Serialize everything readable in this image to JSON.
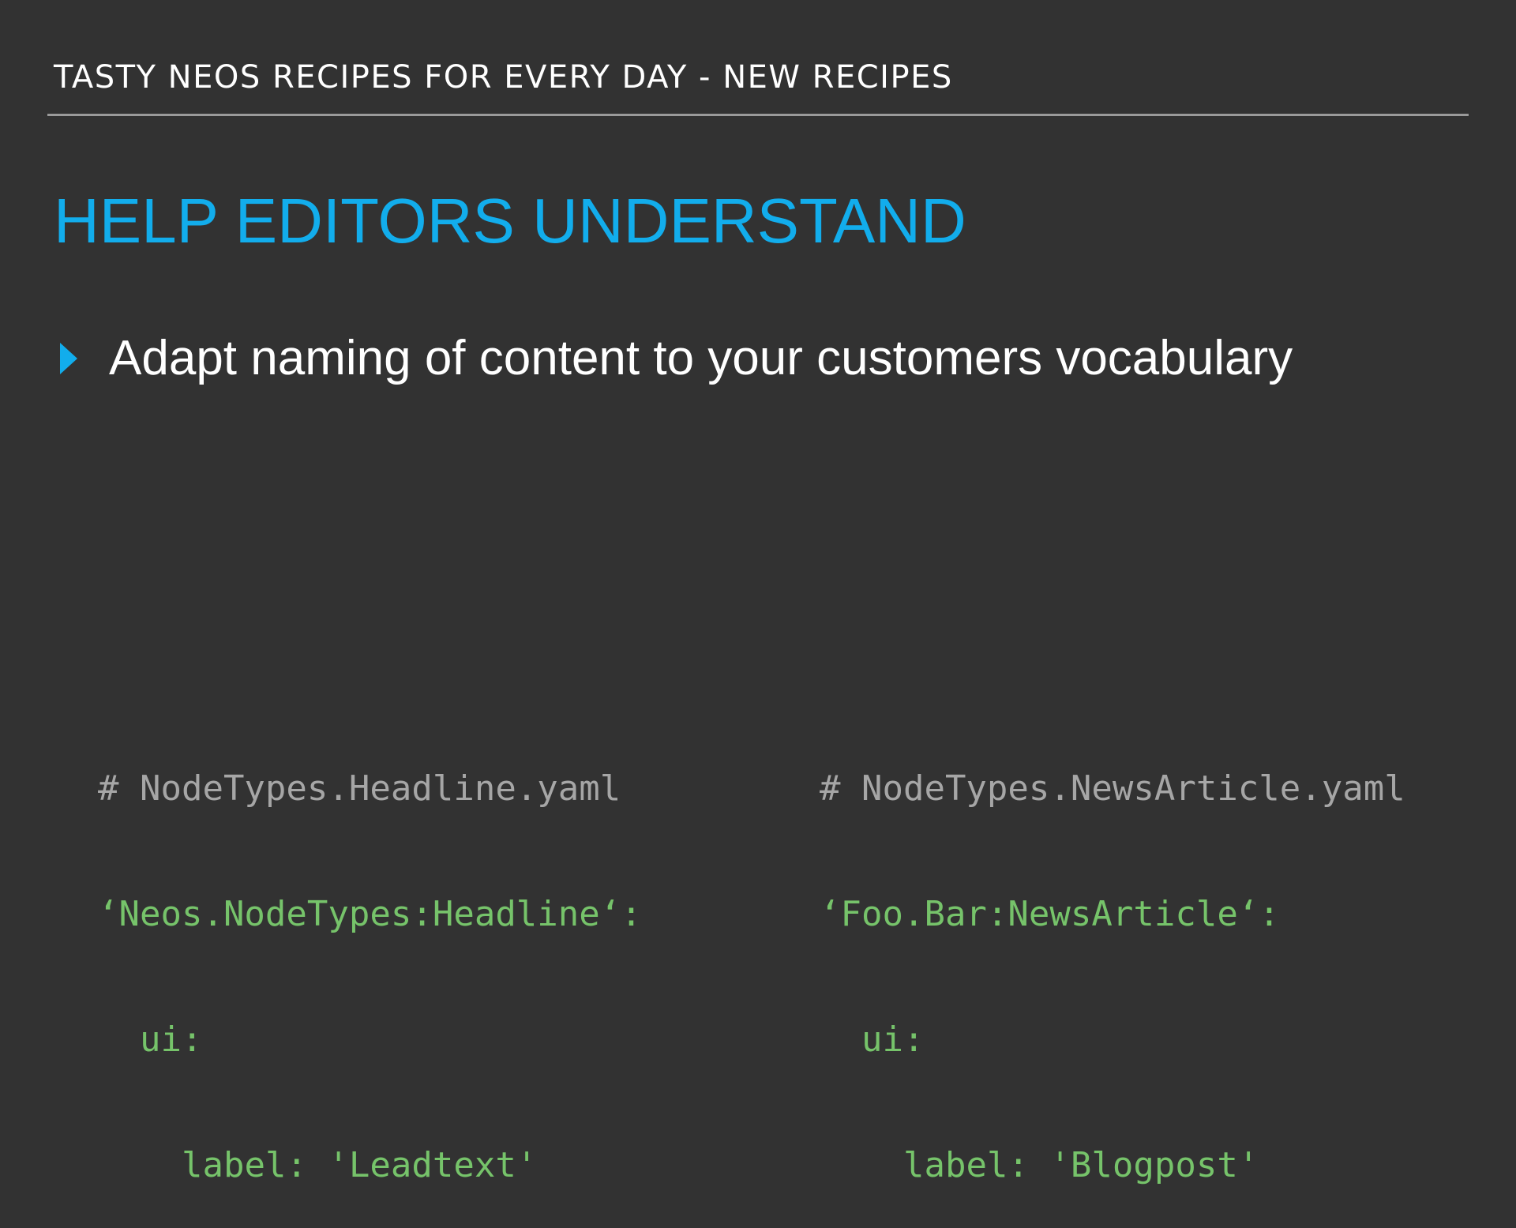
{
  "header": {
    "title": "TASTY NEOS RECIPES FOR EVERY DAY - NEW RECIPES"
  },
  "slide": {
    "title": "HELP EDITORS UNDERSTAND",
    "bullets": [
      "Adapt naming of content to your customers vocabulary"
    ]
  },
  "code_blocks": [
    {
      "comment": "# NodeTypes.Headline.yaml",
      "node_type": "‘Neos.NodeTypes:Headline‘:",
      "ui_key": "ui:",
      "label_line": "label: 'Leadtext'"
    },
    {
      "comment": "# NodeTypes.NewsArticle.yaml",
      "node_type": "‘Foo.Bar:NewsArticle‘:",
      "ui_key": "ui:",
      "label_line": "label: 'Blogpost'"
    }
  ],
  "colors": {
    "background": "#323232",
    "accent": "#12adec",
    "code_comment": "#a6a6a6",
    "code_yaml": "#76c36a",
    "rule": "#9a9a9a"
  },
  "icons": {
    "bullet": "triangle-right-icon"
  }
}
